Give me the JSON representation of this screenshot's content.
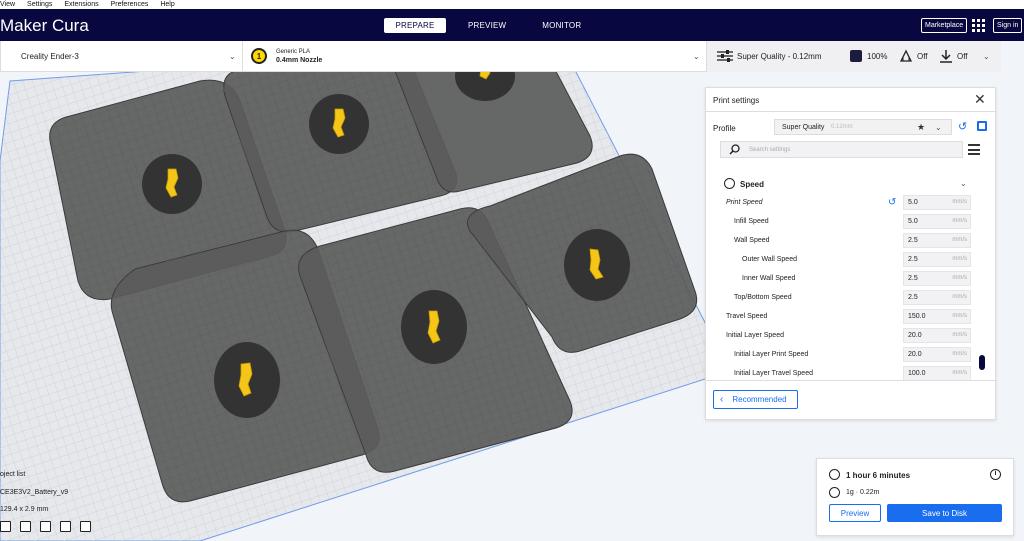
{
  "menu": [
    "View",
    "Settings",
    "Extensions",
    "Preferences",
    "Help"
  ],
  "app": {
    "brand": "Maker Cura"
  },
  "stages": [
    {
      "label": "PREPARE",
      "active": true
    },
    {
      "label": "PREVIEW",
      "active": false
    },
    {
      "label": "MONITOR",
      "active": false
    }
  ],
  "header": {
    "marketplace": "Marketplace",
    "signin": "Sign in"
  },
  "printer": {
    "name": "Creality Ender-3"
  },
  "material": {
    "extruder": "1",
    "name": "Generic PLA",
    "nozzle": "0.4mm Nozzle"
  },
  "quality": {
    "profile": "Super Quality - 0.12mm",
    "infill": "100%",
    "support": "Off",
    "adhesion": "Off"
  },
  "print_settings": {
    "title": "Print settings",
    "profile_label": "Profile",
    "profile_name": "Super Quality",
    "profile_sub": "0.12mm",
    "search_placeholder": "Search settings",
    "category": "Speed",
    "rows": [
      {
        "label": "Print Speed",
        "value": "5.0",
        "unit": "mm/s",
        "italic": true,
        "resettable": true
      },
      {
        "label": "Infill Speed",
        "value": "5.0",
        "unit": "mm/s"
      },
      {
        "label": "Wall Speed",
        "value": "2.5",
        "unit": "mm/s"
      },
      {
        "label": "Outer Wall Speed",
        "value": "2.5",
        "unit": "mm/s"
      },
      {
        "label": "Inner Wall Speed",
        "value": "2.5",
        "unit": "mm/s"
      },
      {
        "label": "Top/Bottom Speed",
        "value": "2.5",
        "unit": "mm/s"
      },
      {
        "label": "Travel Speed",
        "value": "150.0",
        "unit": "mm/s"
      },
      {
        "label": "Initial Layer Speed",
        "value": "20.0",
        "unit": "mm/s"
      },
      {
        "label": "Initial Layer Print Speed",
        "value": "20.0",
        "unit": "mm/s"
      },
      {
        "label": "Initial Layer Travel Speed",
        "value": "100.0",
        "unit": "mm/s"
      }
    ],
    "recommended": "Recommended"
  },
  "objects": {
    "list_label": "oject list",
    "name": "CE3E3V2_Battery_v9",
    "dims": "129.4 x 2.9 mm"
  },
  "action": {
    "time": "1 hour 6 minutes",
    "usage": "1g · 0.22m",
    "preview": "Preview",
    "save": "Save to Disk"
  },
  "colors": {
    "header": "#08073f",
    "accent": "#196ef0",
    "part": "#f5c518"
  }
}
